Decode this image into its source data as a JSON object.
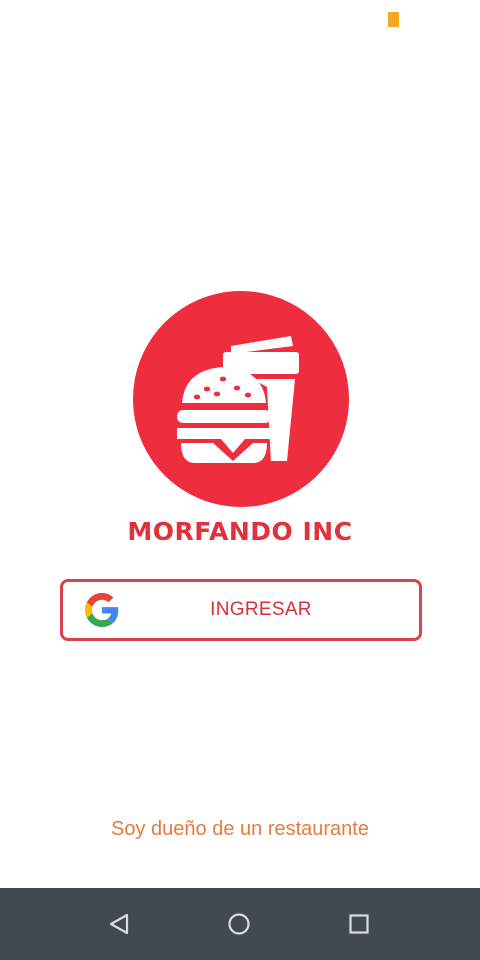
{
  "status_bar": {
    "indicator_color": "#f5a623"
  },
  "logo": {
    "icon": "burger-and-drink-icon",
    "circle_color": "#ee2e3f"
  },
  "brand": {
    "title": "MORFANDO INC"
  },
  "login": {
    "icon": "google-g-icon",
    "label": "INGRESAR",
    "border_color": "#d94350"
  },
  "owner": {
    "link_text": "Soy dueño de un restaurante",
    "color": "#e87a3d"
  },
  "nav_bar": {
    "background": "#424953",
    "buttons": [
      {
        "icon": "back-triangle-icon"
      },
      {
        "icon": "home-circle-icon"
      },
      {
        "icon": "recents-square-icon"
      }
    ]
  }
}
